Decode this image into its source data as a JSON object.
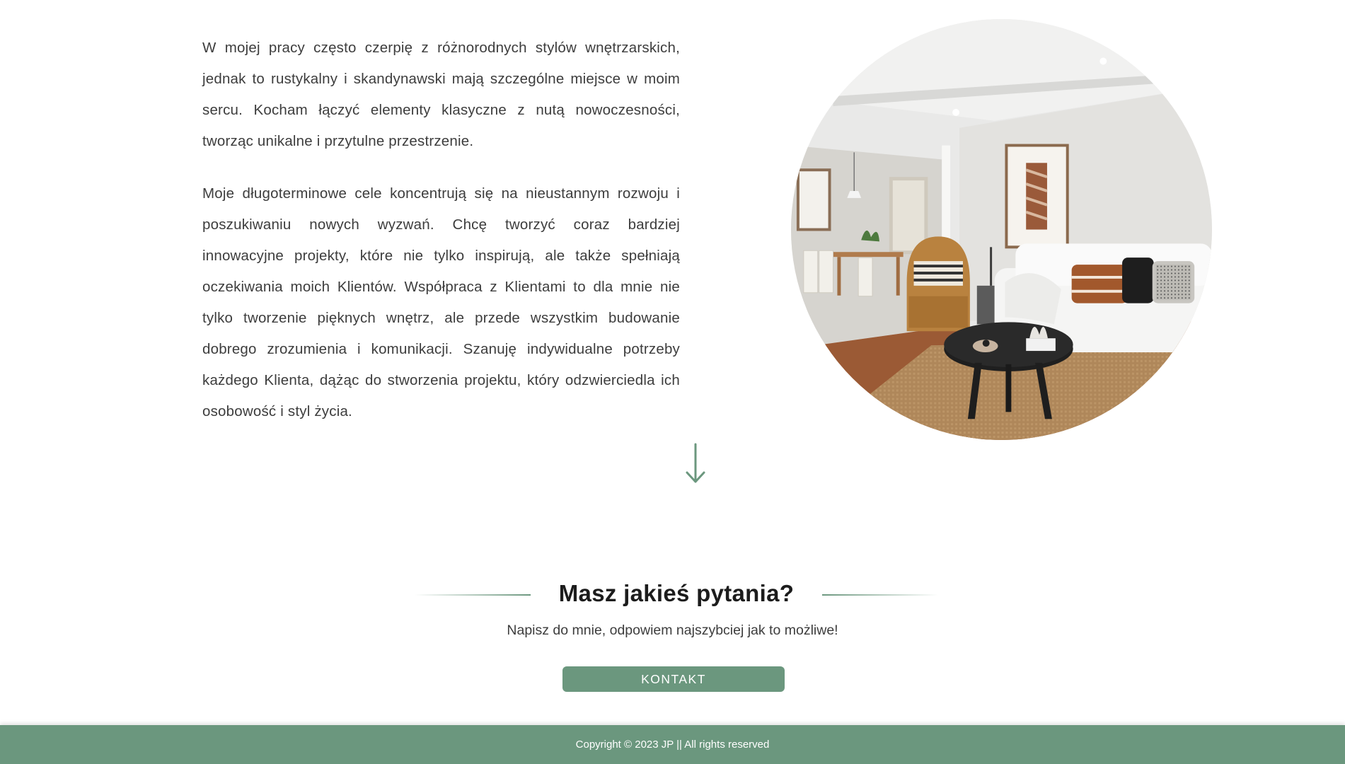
{
  "about": {
    "paragraph_1": "W mojej pracy często czerpię z różnorodnych stylów wnętrzarskich, jednak to rustykalny i skandynawski mają szczególne miejsce w moim sercu. Kocham łączyć elementy klasyczne z nutą nowoczesności, tworząc unikalne i przytulne przestrzenie.",
    "paragraph_2": "Moje długoterminowe cele koncentrują się na nieustannym rozwoju i poszukiwaniu nowych wyzwań. Chcę tworzyć coraz bardziej innowacyjne projekty, które nie tylko inspirują, ale także spełniają oczekiwania moich Klientów. Współpraca z Klientami to dla mnie nie tylko tworzenie pięknych wnętrz, ale przede wszystkim budowanie dobrego zrozumienia i komunikacji. Szanuję indywidualne potrzeby każdego Klienta, dążąc do stworzenia projektu, który odzwierciedla ich osobowość i styl życia."
  },
  "contact": {
    "heading": "Masz jakieś pytania?",
    "subheading": "Napisz do mnie, odpowiem najszybciej jak to możliwe!",
    "button_label": "KONTAKT"
  },
  "footer": {
    "copyright": "Copyright © 2023 JP || All rights reserved"
  },
  "colors": {
    "accent": "#6b977e",
    "text": "#3d3d3d",
    "heading": "#1c1c1c",
    "background": "#ffffff"
  },
  "icons": {
    "scroll": "arrow-down-icon"
  }
}
